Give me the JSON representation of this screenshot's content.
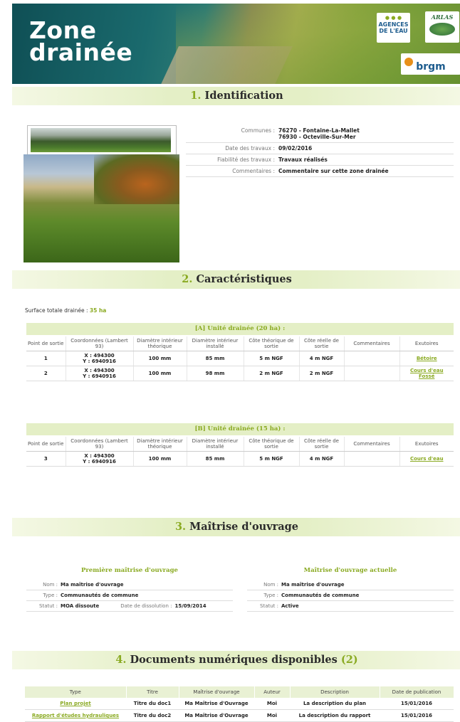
{
  "banner": {
    "title_line1": "Zone",
    "title_line2": "drainée",
    "logo_agences": "AGENCES DE L'EAU",
    "logo_arlas": "ARLAS",
    "logo_brgm": "brgm"
  },
  "sections": {
    "s1": {
      "num": "1.",
      "title": "Identification"
    },
    "s2": {
      "num": "2.",
      "title": "Caractéristiques"
    },
    "s3": {
      "num": "3.",
      "title": "Maîtrise d'ouvrage"
    },
    "s4": {
      "num": "4.",
      "title": "Documents numériques disponibles",
      "count": "(2)"
    }
  },
  "identification": {
    "communes_label": "Communes :",
    "communes_1": "76270 - Fontaine-La-Mallet",
    "communes_2": "76930 - Octeville-Sur-Mer",
    "date_label": "Date des travaux :",
    "date_value": "09/02/2016",
    "fiabilite_label": "Fiabilité des travaux :",
    "fiabilite_value": "Travaux réalisés",
    "commentaires_label": "Commentaires :",
    "commentaires_value": "Commentaire sur cette zone drainée"
  },
  "caracteristiques": {
    "surface_label": "Surface totale drainée :",
    "surface_value": "35 ha",
    "headers": [
      "Point de sortie",
      "Coordonnées (Lambert 93)",
      "Diamètre intérieur théorique",
      "Diamètre intérieur installé",
      "Côte théorique de sortie",
      "Côte réelle de sortie",
      "Commentaires",
      "Exutoires"
    ],
    "unit_a": {
      "title": "[A] Unité drainée (20 ha) :",
      "rows": [
        {
          "point": "1",
          "x": "X : 494300",
          "y": "Y : 6940916",
          "d_theo": "100 mm",
          "d_inst": "85 mm",
          "c_theo": "5 m NGF",
          "c_reel": "4 m NGF",
          "comment": "",
          "exutoires": [
            "Bétoire"
          ]
        },
        {
          "point": "2",
          "x": "X : 494300",
          "y": "Y : 6940916",
          "d_theo": "100 mm",
          "d_inst": "98 mm",
          "c_theo": "2 m NGF",
          "c_reel": "2 m NGF",
          "comment": "",
          "exutoires": [
            "Cours d'eau",
            "Fossé"
          ]
        }
      ]
    },
    "unit_b": {
      "title": "[B] Unité drainée (15 ha) :",
      "rows": [
        {
          "point": "3",
          "x": "X : 494300",
          "y": "Y : 6940916",
          "d_theo": "100 mm",
          "d_inst": "85 mm",
          "c_theo": "5 m NGF",
          "c_reel": "4 m NGF",
          "comment": "",
          "exutoires": [
            "Cours d'eau"
          ]
        }
      ]
    }
  },
  "moa": {
    "premiere": {
      "title": "Première maîtrise d'ouvrage",
      "nom_label": "Nom :",
      "nom": "Ma maîtrise d'ouvrage",
      "type_label": "Type :",
      "type": "Communautés de commune",
      "statut_label": "Statut :",
      "statut": "MOA dissoute",
      "dissolution_label": "Date de dissolution :",
      "dissolution": "15/09/2014"
    },
    "actuelle": {
      "title": "Maîtrise d'ouvrage actuelle",
      "nom_label": "Nom :",
      "nom": "Ma maîtrise d'ouvrage",
      "type_label": "Type :",
      "type": "Communautés de commune",
      "statut_label": "Statut :",
      "statut": "Active"
    }
  },
  "documents": {
    "headers": [
      "Type",
      "Titre",
      "Maîtrise d'ouvrage",
      "Auteur",
      "Description",
      "Date de publication"
    ],
    "rows": [
      {
        "type": "Plan projet",
        "titre": "Titre du doc1",
        "moa": "Ma Maîtrise d'Ouvrage",
        "auteur": "Moi",
        "description": "La description du plan",
        "date": "15/01/2016"
      },
      {
        "type": "Rapport d'études hydrauliques",
        "titre": "Titre du doc2",
        "moa": "Ma Maîtrise d'Ouvrage",
        "auteur": "Moi",
        "description": "La description du rapport",
        "date": "15/01/2016"
      }
    ]
  }
}
